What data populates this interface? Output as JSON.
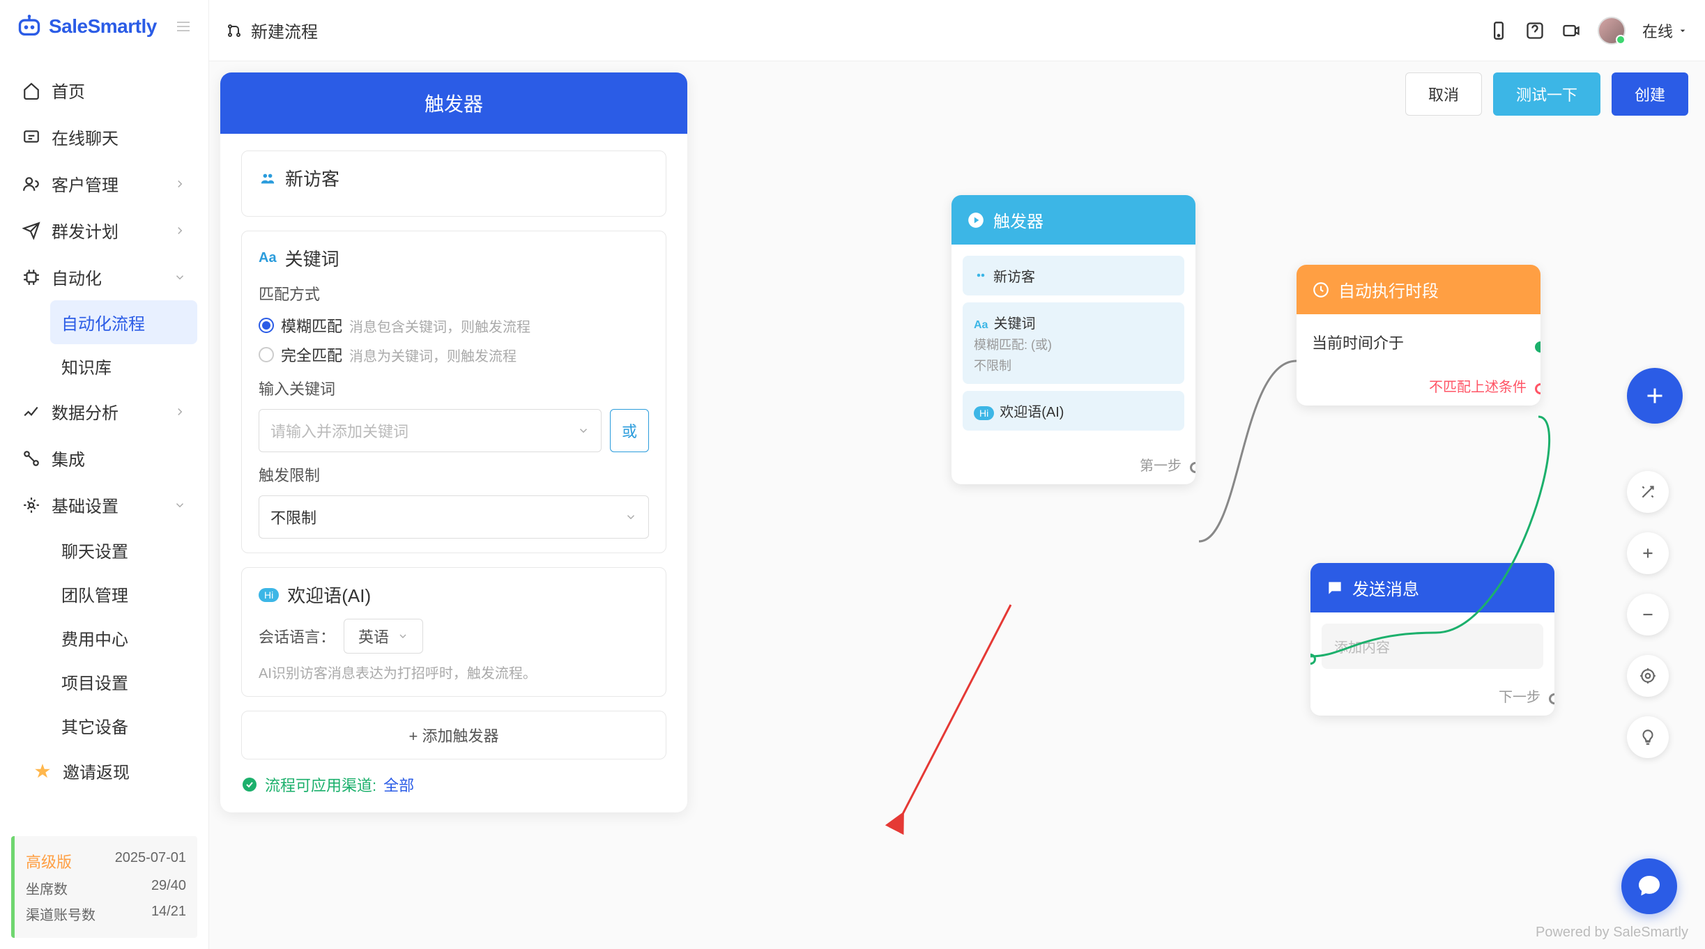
{
  "brand": "SaleSmartly",
  "header": {
    "new_flow": "新建流程",
    "status": "在线"
  },
  "actions": {
    "cancel": "取消",
    "test": "测试一下",
    "create": "创建"
  },
  "sidebar": {
    "items": [
      {
        "label": "首页"
      },
      {
        "label": "在线聊天"
      },
      {
        "label": "客户管理"
      },
      {
        "label": "群发计划"
      },
      {
        "label": "自动化"
      },
      {
        "label": "数据分析"
      },
      {
        "label": "集成"
      },
      {
        "label": "基础设置"
      }
    ],
    "automation_sub": [
      {
        "label": "自动化流程"
      },
      {
        "label": "知识库"
      }
    ],
    "settings_sub": [
      {
        "label": "聊天设置"
      },
      {
        "label": "团队管理"
      },
      {
        "label": "费用中心"
      },
      {
        "label": "项目设置"
      },
      {
        "label": "其它设备"
      }
    ],
    "invite": "邀请返现"
  },
  "plan": {
    "name": "高级版",
    "expiry": "2025-07-01",
    "seats_label": "坐席数",
    "seats_val": "29/40",
    "channels_label": "渠道账号数",
    "channels_val": "14/21"
  },
  "config": {
    "title": "触发器",
    "new_visitor": "新访客",
    "keyword": "关键词",
    "match_label": "匹配方式",
    "fuzzy": "模糊匹配",
    "fuzzy_hint": "消息包含关键词，则触发流程",
    "exact": "完全匹配",
    "exact_hint": "消息为关键词，则触发流程",
    "input_kw_label": "输入关键词",
    "input_kw_placeholder": "请输入并添加关键词",
    "or": "或",
    "limit_label": "触发限制",
    "limit_val": "不限制",
    "greeting": "欢迎语(AI)",
    "lang_label": "会话语言：",
    "lang_val": "英语",
    "ai_hint": "AI识别访客消息表达为打招呼时，触发流程。",
    "add_trigger": "+ 添加触发器",
    "channel_label": "流程可应用渠道:",
    "channel_val": "全部"
  },
  "flow": {
    "trigger": {
      "title": "触发器",
      "new_visitor": "新访客",
      "keyword": "关键词",
      "keyword_sub1": "模糊匹配: (或)",
      "keyword_sub2": "不限制",
      "greeting": "欢迎语(AI)",
      "step": "第一步"
    },
    "schedule": {
      "title": "自动执行时段",
      "body": "当前时间介于",
      "nomatch": "不匹配上述条件"
    },
    "send": {
      "title": "发送消息",
      "placeholder": "添加内容",
      "step": "下一步"
    }
  },
  "powered": "Powered by SaleSmartly"
}
